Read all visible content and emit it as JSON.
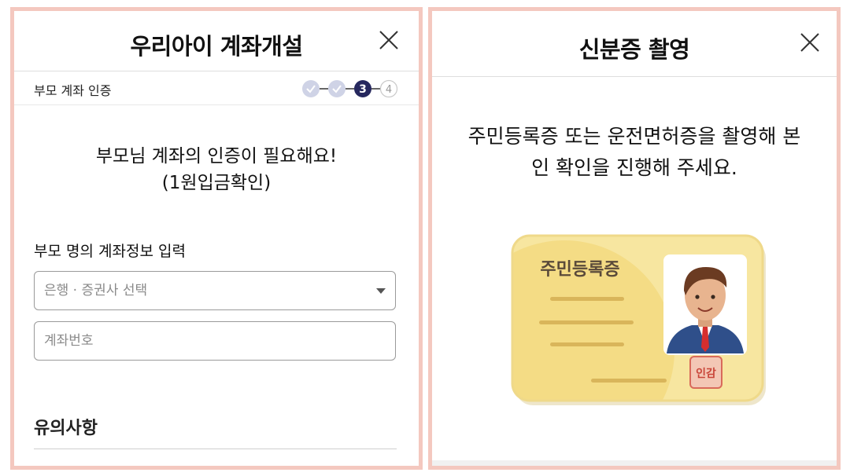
{
  "left_panel": {
    "title": "우리아이 계좌개설",
    "step_label": "부모 계좌 인증",
    "steps": {
      "current": "3",
      "next": "4"
    },
    "lead_line1": "부모님 계좌의 인증이 필요해요!",
    "lead_line2": "(1원입금확인)",
    "section_label": "부모 명의 계좌정보 입력",
    "bank_select_placeholder": "은행 · 증권사 선택",
    "account_placeholder": "계좌번호",
    "notes_title": "유의사항"
  },
  "right_panel": {
    "title": "신분증 촬영",
    "instruction_line1": "주민등록증 또는 운전면허증을 촬영해 본",
    "instruction_line2": "인 확인을 진행해 주세요.",
    "id_card_title": "주민등록증",
    "seal_text": "인감"
  },
  "colors": {
    "panel_border": "#f4c8bf",
    "step_done": "#cfd3e6",
    "step_current": "#26285e",
    "card_yellow": "#f6e08a"
  }
}
